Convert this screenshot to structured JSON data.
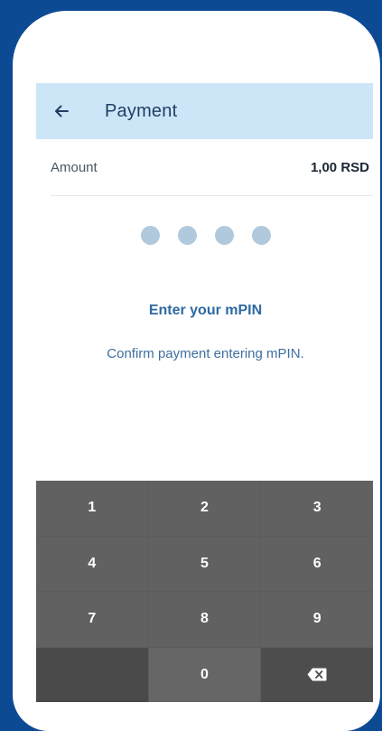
{
  "header": {
    "back_icon": "arrow-left-icon",
    "title": "Payment"
  },
  "amount": {
    "label": "Amount",
    "value": "1,00 RSD"
  },
  "pin": {
    "dot_count": 4,
    "entered": 0,
    "dot_color": "#b1c9dc"
  },
  "prompt": {
    "title": "Enter your mPIN",
    "subtitle": "Confirm payment entering mPIN."
  },
  "keypad": {
    "keys": [
      "1",
      "2",
      "3",
      "4",
      "5",
      "6",
      "7",
      "8",
      "9",
      "",
      "0",
      "backspace"
    ],
    "backspace_icon": "backspace-icon"
  },
  "colors": {
    "background": "#0d4a94",
    "app_bar": "#cde6f7",
    "accent_text": "#2e6aa1",
    "keypad": "#616161"
  }
}
